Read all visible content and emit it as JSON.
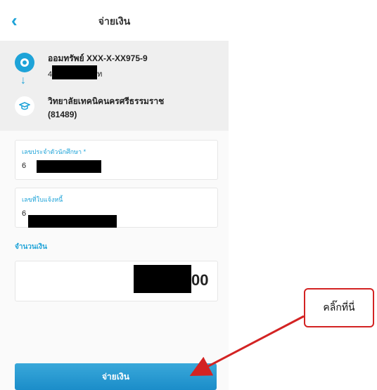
{
  "header": {
    "title": "จ่ายเงิน",
    "back_icon": "chevron-left-icon"
  },
  "from_account": {
    "name": "ออมทรัพย์ XXX-X-XX975-9",
    "balance_prefix": "4",
    "balance_suffix": "ท"
  },
  "to_account": {
    "name": "วิทยาลัยเทคนิคนครศรีธรรมราช",
    "code": "(81489)"
  },
  "fields": {
    "student_id": {
      "label": "เลขประจำตัวนักศึกษา *",
      "value_prefix": "6"
    },
    "invoice_no": {
      "label": "เลขที่ใบแจ้งหนี้",
      "value_prefix": "6"
    }
  },
  "amount": {
    "label": "จำนวนเงิน",
    "value_suffix": "00"
  },
  "pay_button": {
    "label": "จ่ายเงิน"
  },
  "annotation": {
    "text": "คลิ๊กที่นี่",
    "color": "#d32323"
  },
  "colors": {
    "accent": "#1ea3d8"
  }
}
